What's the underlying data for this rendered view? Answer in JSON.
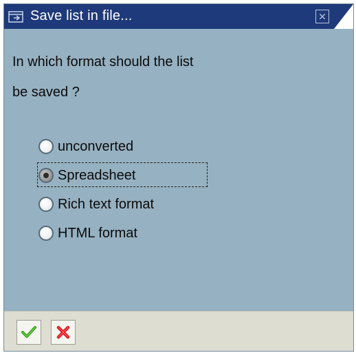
{
  "window": {
    "title": "Save list in file..."
  },
  "question": {
    "line1": "In which format should the list",
    "line2": "be saved ?"
  },
  "formats": [
    {
      "label": "unconverted",
      "selected": false
    },
    {
      "label": "Spreadsheet",
      "selected": true
    },
    {
      "label": "Rich text format",
      "selected": false
    },
    {
      "label": "HTML format",
      "selected": false
    }
  ],
  "icons": {
    "title": "window-icon",
    "close": "close-icon",
    "ok": "check-icon",
    "cancel": "cancel-icon"
  },
  "colors": {
    "titlebar": "#1f3a7a",
    "body": "#96b1c1",
    "footer": "#deddd2",
    "ok": "#2e9a16",
    "cancel": "#d8121c"
  }
}
